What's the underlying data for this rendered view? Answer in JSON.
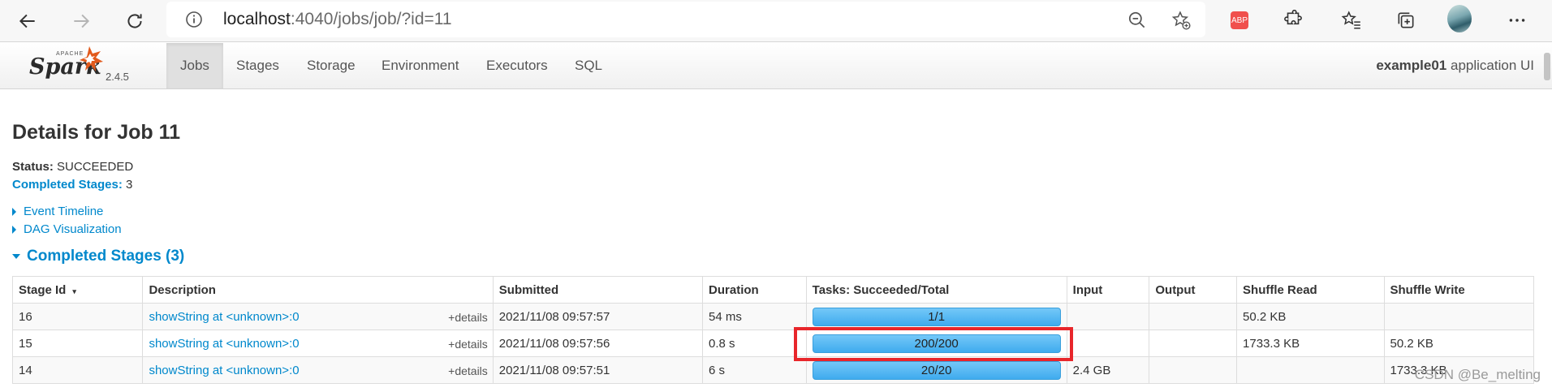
{
  "browser": {
    "url_host": "localhost",
    "url_path": ":4040/jobs/job/?id=11",
    "ext_label": "ABP"
  },
  "navbar": {
    "brand_apache": "APACHE",
    "brand_name": "Spark",
    "version": "2.4.5",
    "tabs": [
      {
        "label": "Jobs",
        "active": true
      },
      {
        "label": "Stages"
      },
      {
        "label": "Storage"
      },
      {
        "label": "Environment"
      },
      {
        "label": "Executors"
      },
      {
        "label": "SQL"
      }
    ],
    "app_name": "example01",
    "app_suffix": " application UI"
  },
  "page": {
    "title": "Details for Job 11",
    "status_label": "Status:",
    "status_value": " SUCCEEDED",
    "completed_label": "Completed Stages:",
    "completed_value": " 3",
    "event_timeline": "Event Timeline",
    "dag_visualization": "DAG Visualization",
    "section_title": "Completed Stages (3)"
  },
  "table": {
    "headers": [
      "Stage Id",
      "Description",
      "Submitted",
      "Duration",
      "Tasks: Succeeded/Total",
      "Input",
      "Output",
      "Shuffle Read",
      "Shuffle Write"
    ],
    "sort_indicator": "▾",
    "details_label": "+details",
    "rows": [
      {
        "stage_id": "16",
        "description": "showString at <unknown>:0",
        "submitted": "2021/11/08 09:57:57",
        "duration": "54 ms",
        "tasks": "1/1",
        "progress": 1.0,
        "input": "",
        "output": "",
        "shuffle_read": "50.2 KB",
        "shuffle_write": ""
      },
      {
        "stage_id": "15",
        "description": "showString at <unknown>:0",
        "submitted": "2021/11/08 09:57:56",
        "duration": "0.8 s",
        "tasks": "200/200",
        "progress": 1.0,
        "input": "",
        "output": "",
        "shuffle_read": "1733.3 KB",
        "shuffle_write": "50.2 KB"
      },
      {
        "stage_id": "14",
        "description": "showString at <unknown>:0",
        "submitted": "2021/11/08 09:57:51",
        "duration": "6 s",
        "tasks": "20/20",
        "progress": 1.0,
        "input": "2.4 GB",
        "output": "",
        "shuffle_read": "",
        "shuffle_write": "1733.3 KB"
      }
    ]
  },
  "watermark": "CSDN @Be_melting",
  "colors": {
    "link": "#0088cc",
    "progress": "#53b8f5",
    "highlight": "#e8262b"
  }
}
